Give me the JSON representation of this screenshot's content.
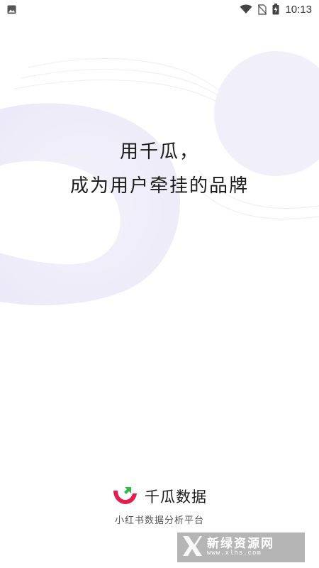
{
  "status_bar": {
    "time": "10:13",
    "icons": [
      "image-notification-icon",
      "wifi-icon",
      "no-sim-icon",
      "battery-charging-icon"
    ]
  },
  "slogan": {
    "line1": "用千瓜，",
    "line2": "成为用户牵挂的品牌"
  },
  "brand": {
    "name": "千瓜数据",
    "subtitle": "小红书数据分析平台",
    "logo_colors": [
      "#e0214f",
      "#36b54a"
    ]
  },
  "watermark": {
    "title": "新绿资源网",
    "url": "www.xlhs.com"
  },
  "colors": {
    "background": "#ffffff",
    "decor": "#efeef9",
    "text": "#1a1a1a"
  }
}
